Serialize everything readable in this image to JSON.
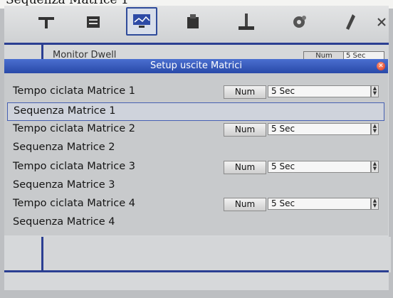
{
  "caption": "Sequenza Matrice 1",
  "toolbar": {
    "icons": [
      "mold-icon",
      "machine-icon",
      "monitor-icon",
      "injection-icon",
      "press-icon",
      "gear-icon",
      "tool-icon",
      "close-x-icon"
    ]
  },
  "background": {
    "row_label": "Monitor Dwell",
    "num_label": "Num",
    "value": "5 Sec"
  },
  "dialog": {
    "title": "Setup uscite Matrici",
    "rows": [
      {
        "label": "Tempo ciclata Matrice 1",
        "button": "Num",
        "value": "5 Sec"
      },
      {
        "label": "Sequenza Matrice 1"
      },
      {
        "label": "Tempo ciclata Matrice 2",
        "button": "Num",
        "value": "5 Sec"
      },
      {
        "label": "Sequenza Matrice 2"
      },
      {
        "label": "Tempo ciclata Matrice 3",
        "button": "Num",
        "value": "5 Sec"
      },
      {
        "label": "Sequenza Matrice 3"
      },
      {
        "label": "Tempo ciclata Matrice 4",
        "button": "Num",
        "value": "5 Sec"
      },
      {
        "label": "Sequenza Matrice 4"
      }
    ]
  },
  "colors": {
    "titlebar": "#2949a8",
    "accent_line": "#2b3f92",
    "close_button": "#d9321a"
  }
}
